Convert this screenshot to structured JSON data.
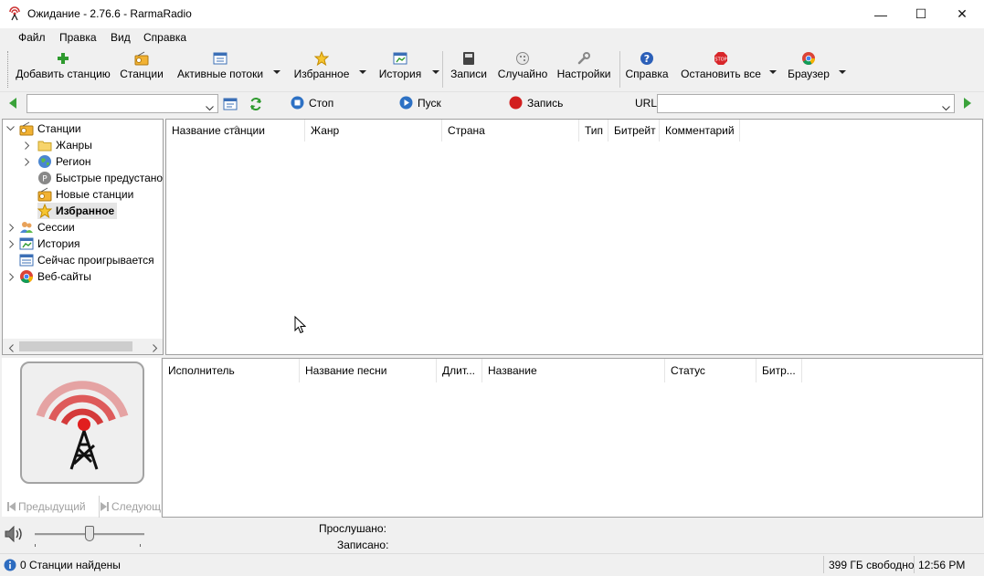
{
  "window": {
    "title": "Ожидание - 2.76.6 - RarmaRadio",
    "minimize": "—",
    "maximize": "☐",
    "close": "✕"
  },
  "menu": [
    "Файл",
    "Правка",
    "Вид",
    "Справка"
  ],
  "toolbar": {
    "add_station": "Добавить станцию",
    "stations": "Станции",
    "active_streams": "Активные потоки",
    "favorites": "Избранное",
    "history": "История",
    "records": "Записи",
    "random": "Случайно",
    "settings": "Настройки",
    "help": "Справка",
    "stop_all": "Остановить все",
    "browser": "Браузер"
  },
  "addressbar": {
    "station_combo_value": "",
    "stop": "Стоп",
    "play": "Пуск",
    "record": "Запись",
    "url_label": "URL",
    "url_value": ""
  },
  "tree": {
    "items": [
      {
        "label": "Станции",
        "icon": "radio-icon"
      },
      {
        "label": "Жанры",
        "icon": "folder-icon"
      },
      {
        "label": "Регион",
        "icon": "globe-icon"
      },
      {
        "label": "Быстрые предустано",
        "icon": "preset-icon"
      },
      {
        "label": "Новые станции",
        "icon": "radio-icon"
      },
      {
        "label": "Избранное",
        "icon": "star-icon"
      },
      {
        "label": "Сессии",
        "icon": "users-icon"
      },
      {
        "label": "История",
        "icon": "history-icon"
      },
      {
        "label": "Сейчас проигрывается",
        "icon": "list-icon"
      },
      {
        "label": "Веб-сайты",
        "icon": "chrome-icon"
      }
    ]
  },
  "stations_table": {
    "columns": [
      "Название станции",
      "Жанр",
      "Страна",
      "Тип",
      "Битрейт",
      "Комментарий"
    ],
    "rows": []
  },
  "songs_table": {
    "columns": [
      "Исполнитель",
      "Название песни",
      "Длит...",
      "Название",
      "Статус",
      "Битр..."
    ],
    "rows": []
  },
  "player": {
    "prev": "Предыдущий",
    "next": "Следующий",
    "listened_label": "Прослушано:",
    "listened_value": "",
    "recorded_label": "Записано:",
    "recorded_value": "",
    "volume_fraction": 0.5
  },
  "statusbar": {
    "stations_found": "0 Станции найдены",
    "disk_free": "399 ГБ свободно",
    "clock": "12:56 PM"
  },
  "colors": {
    "accent_red": "#d9342b",
    "green_arrow": "#3aa23a",
    "selection": "#e5e5e5"
  }
}
